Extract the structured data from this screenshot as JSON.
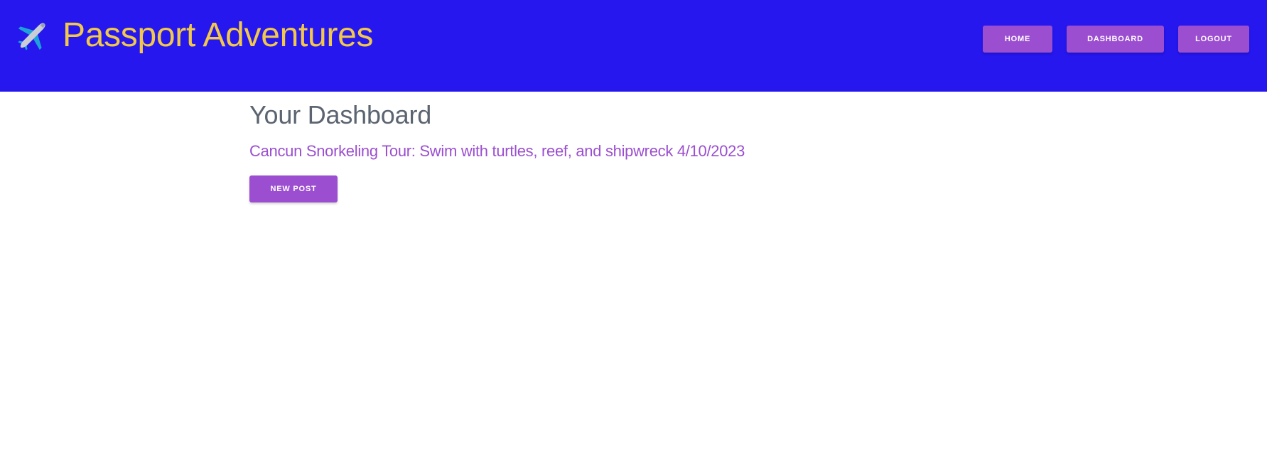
{
  "header": {
    "brand": {
      "title": "Passport Adventures",
      "icon": "airplane-icon"
    },
    "nav": [
      {
        "label": "HOME"
      },
      {
        "label": "DASHBOARD"
      },
      {
        "label": "LOGOUT"
      }
    ]
  },
  "main": {
    "page_title": "Your Dashboard",
    "posts": [
      {
        "title": "Cancun Snorkeling Tour: Swim with turtles, reef, and shipwreck",
        "date": "4/10/2023"
      }
    ],
    "new_post_label": "NEW POST"
  },
  "colors": {
    "header_bg": "#2517ee",
    "brand_text": "#f2c84a",
    "accent": "#9b4fd0",
    "heading": "#5b6470"
  }
}
